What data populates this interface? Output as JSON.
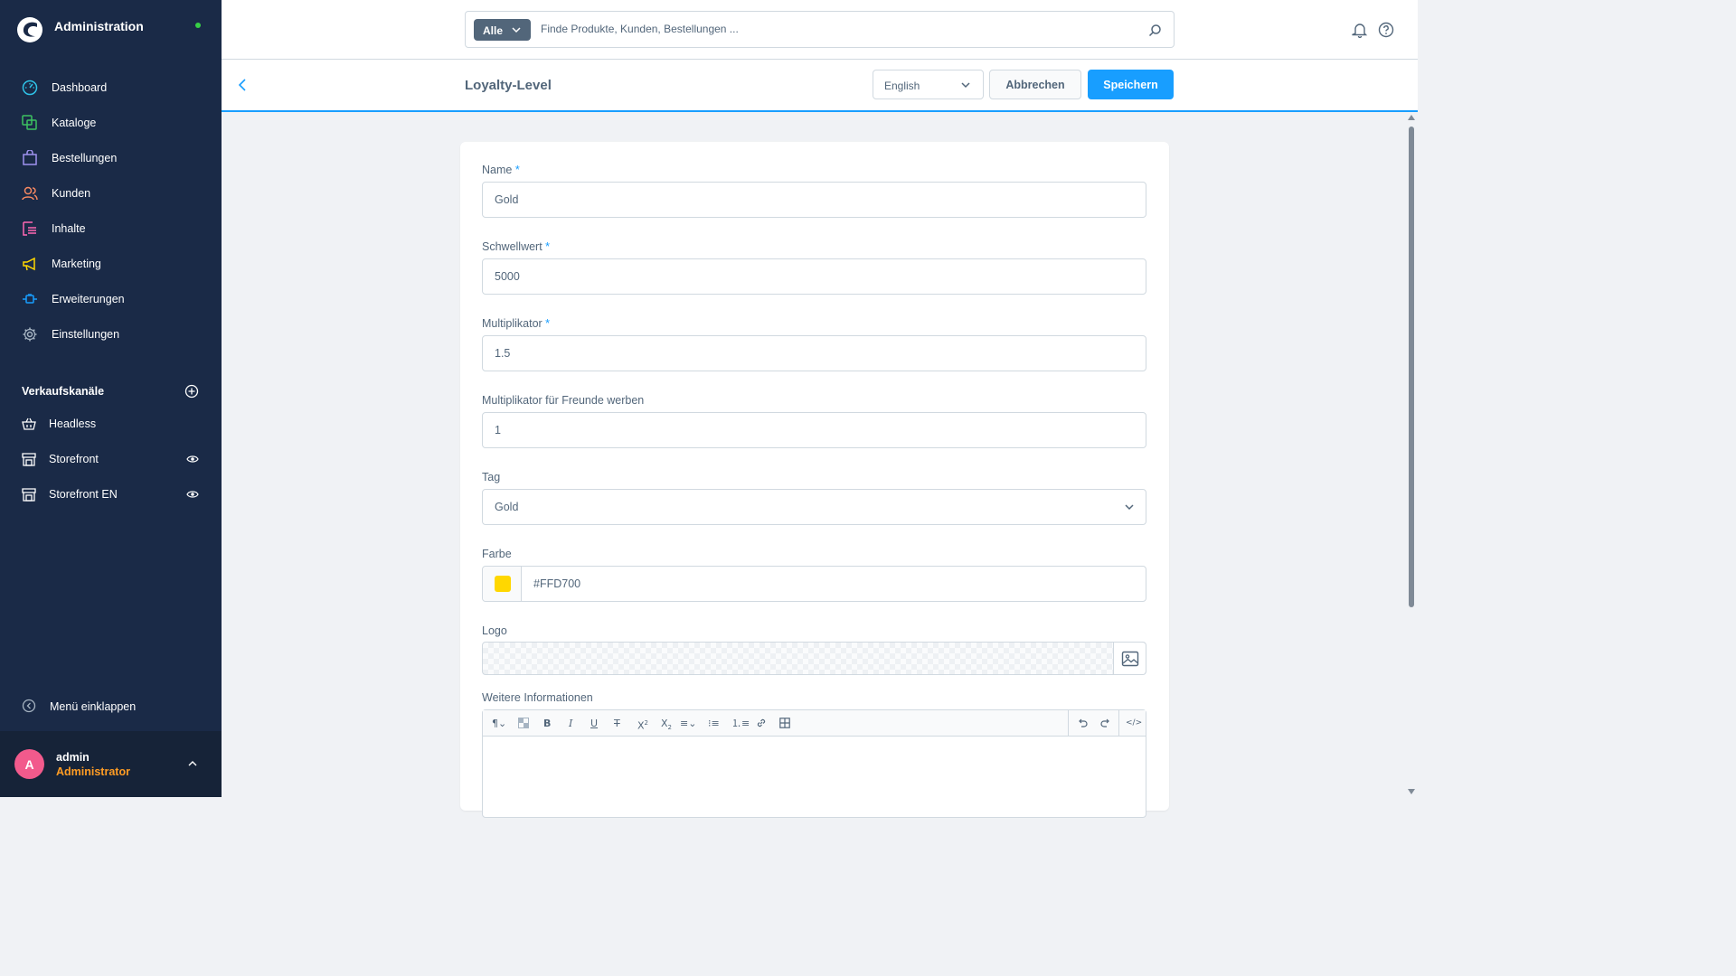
{
  "app": {
    "title": "Administration"
  },
  "sidebar": {
    "items": [
      {
        "label": "Dashboard",
        "icon": "dashboard-icon"
      },
      {
        "label": "Kataloge",
        "icon": "catalog-icon"
      },
      {
        "label": "Bestellungen",
        "icon": "orders-icon"
      },
      {
        "label": "Kunden",
        "icon": "customers-icon"
      },
      {
        "label": "Inhalte",
        "icon": "content-icon"
      },
      {
        "label": "Marketing",
        "icon": "megaphone-icon"
      },
      {
        "label": "Erweiterungen",
        "icon": "plug-icon"
      },
      {
        "label": "Einstellungen",
        "icon": "gear-icon"
      }
    ],
    "sales_channels_title": "Verkaufskanäle",
    "sales_channels": [
      {
        "label": "Headless",
        "icon": "basket-icon"
      },
      {
        "label": "Storefront",
        "icon": "storefront-icon"
      },
      {
        "label": "Storefront EN",
        "icon": "storefront-icon"
      }
    ],
    "collapse_label": "Menü einklappen",
    "user": {
      "initial": "A",
      "name": "admin",
      "role": "Administrator"
    }
  },
  "topbar": {
    "search_type": "Alle",
    "search_placeholder": "Finde Produkte, Kunden, Bestellungen ..."
  },
  "smartbar": {
    "title": "Loyalty-Level",
    "language": "English",
    "cancel_label": "Abbrechen",
    "save_label": "Speichern"
  },
  "form": {
    "name": {
      "label": "Name",
      "required": "*",
      "value": "Gold"
    },
    "threshold": {
      "label": "Schwellwert",
      "required": "*",
      "value": "5000"
    },
    "multiplier": {
      "label": "Multiplikator",
      "required": "*",
      "value": "1.5"
    },
    "referral_multiplier": {
      "label": "Multiplikator für Freunde werben",
      "value": "1"
    },
    "tag": {
      "label": "Tag",
      "value": "Gold"
    },
    "color": {
      "label": "Farbe",
      "value": "#FFD700"
    },
    "logo": {
      "label": "Logo"
    },
    "info": {
      "label": "Weitere Informationen"
    }
  },
  "colors": {
    "sidebar_bg": "#1a2a47",
    "accent": "#189eff",
    "swatch": "#FFD700",
    "avatar": "#f25a8c",
    "role": "#ff9c24"
  }
}
